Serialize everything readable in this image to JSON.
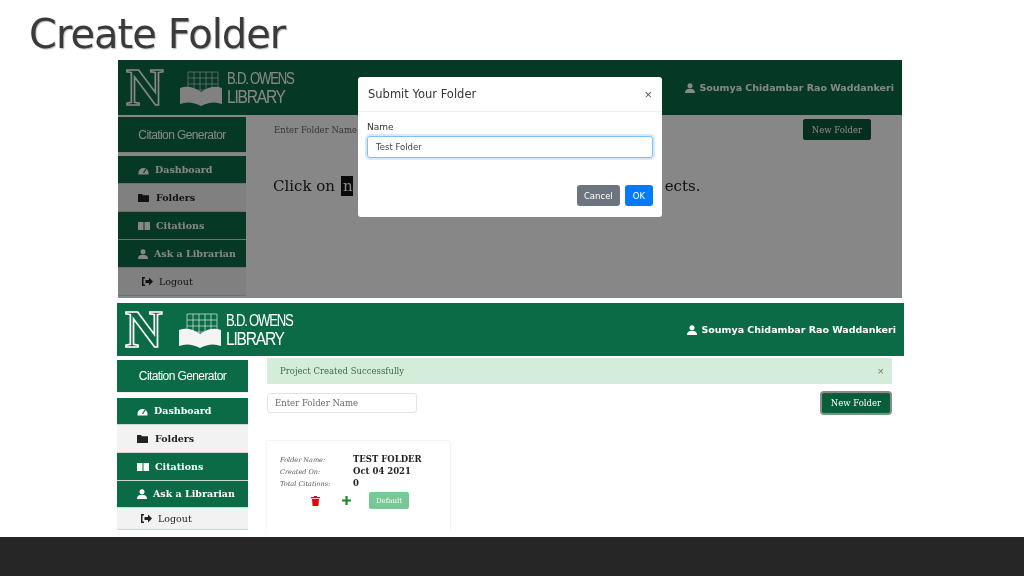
{
  "slide": {
    "title": "Create Folder"
  },
  "screens": [
    {
      "kind": "modal_open",
      "header": {
        "logo_letter": "N",
        "library_name": [
          "B.D. OWENS",
          "LIBRARY"
        ],
        "user": "Soumya Chidambar Rao Waddankeri"
      },
      "sidebar": {
        "title": "Citation Generator",
        "items": [
          {
            "label": "Dashboard",
            "kind": "nav",
            "selected": false
          },
          {
            "label": "Folders",
            "kind": "nav",
            "selected": true
          },
          {
            "label": "Citations",
            "kind": "nav",
            "selected": false
          },
          {
            "label": "Ask a Librarian",
            "kind": "nav",
            "selected": false
          },
          {
            "label": "Logout",
            "kind": "action"
          }
        ]
      },
      "folder_input": {
        "placeholder": "Enter Folder Name"
      },
      "new_folder_button": "New Folder",
      "hint": {
        "before": "Click on",
        "highlight": "n",
        "after": "ects."
      },
      "modal": {
        "title": "Submit Your Folder",
        "close": "×",
        "field_label": "Name",
        "field_value": "Test Folder",
        "buttons": [
          {
            "label": "Cancel",
            "kind": "secondary"
          },
          {
            "label": "OK",
            "kind": "primary"
          }
        ]
      }
    },
    {
      "kind": "folder_list",
      "header": {
        "logo_letter": "N",
        "library_name": [
          "B.D. OWENS",
          "LIBRARY"
        ],
        "user": "Soumya Chidambar Rao Waddankeri"
      },
      "sidebar": {
        "title": "Citation Generator",
        "items": [
          {
            "label": "Dashboard",
            "kind": "nav",
            "selected": false
          },
          {
            "label": "Folders",
            "kind": "nav",
            "selected": true
          },
          {
            "label": "Citations",
            "kind": "nav",
            "selected": false
          },
          {
            "label": "Ask a Librarian",
            "kind": "nav",
            "selected": false
          },
          {
            "label": "Logout",
            "kind": "action"
          }
        ]
      },
      "alert": {
        "message": "Project Created Successfully",
        "close": "×"
      },
      "folder_input": {
        "placeholder": "Enter Folder Name"
      },
      "new_folder_button": "New Folder",
      "folders": [
        {
          "fields": [
            {
              "label": "Folder Name:",
              "value": "TEST FOLDER"
            },
            {
              "label": "Created On:",
              "value": "Oct 04 2021"
            },
            {
              "label": "Total Citations:",
              "value": "0"
            }
          ],
          "default_button": "Default"
        }
      ]
    }
  ]
}
